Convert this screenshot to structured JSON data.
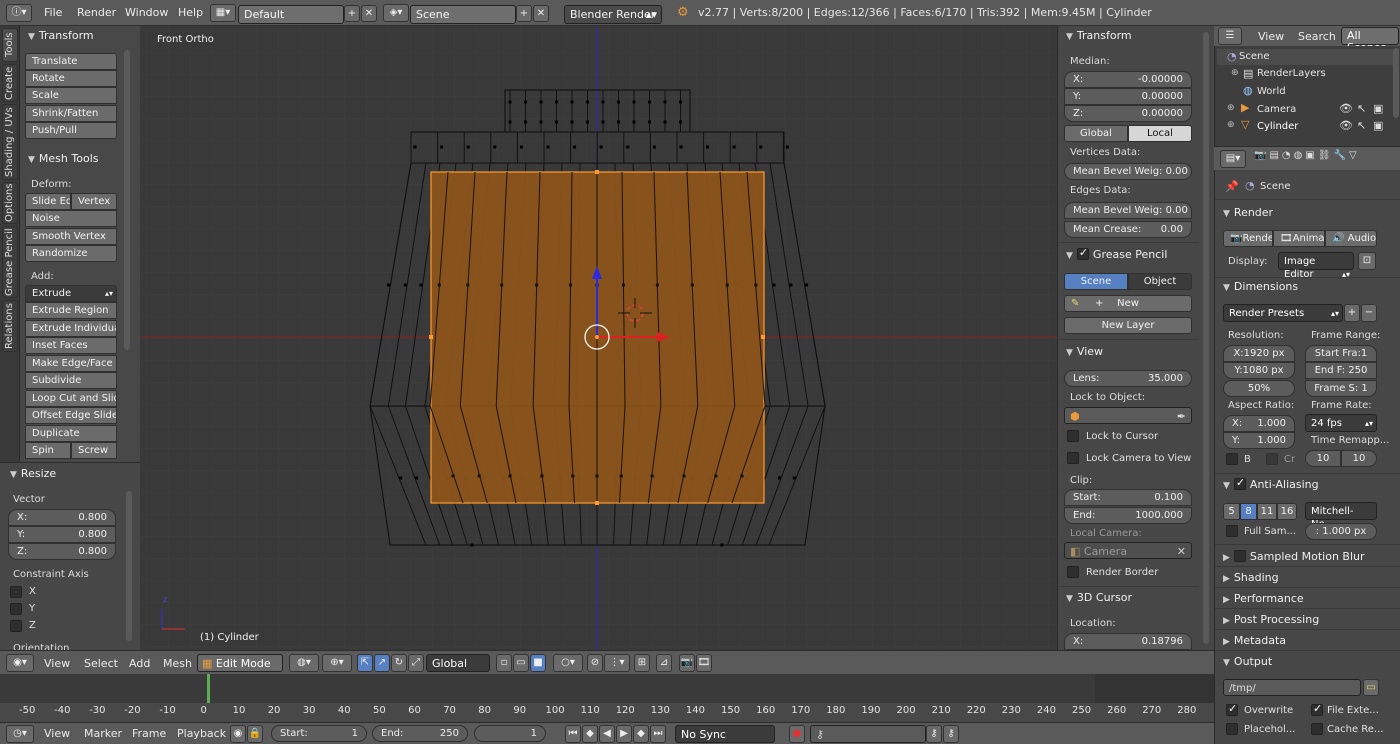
{
  "topbar": {
    "menus": [
      "File",
      "Render",
      "Window",
      "Help"
    ],
    "layout": "Default",
    "scene": "Scene",
    "engine": "Blender Render",
    "stats": "v2.77 | Verts:8/200 | Edges:12/366 | Faces:6/170 | Tris:392 | Mem:9.45M | Cylinder"
  },
  "tool_tabs": [
    "Tools",
    "Create",
    "Shading / UVs",
    "Options",
    "Grease Pencil",
    "Relations"
  ],
  "tools": {
    "transform_header": "Transform",
    "transform_buttons": [
      "Translate",
      "Rotate",
      "Scale",
      "Shrink/Fatten",
      "Push/Pull"
    ],
    "mesh_tools_header": "Mesh Tools",
    "deform_label": "Deform:",
    "slide_edge": "Slide Ed",
    "vertex": "Vertex",
    "deform_buttons": [
      "Noise",
      "Smooth Vertex",
      "Randomize"
    ],
    "add_label": "Add:",
    "extrude": "Extrude",
    "add_buttons": [
      "Extrude Region",
      "Extrude Individual",
      "Inset Faces",
      "Make Edge/Face",
      "Subdivide",
      "Loop Cut and Slide",
      "Offset Edge Slide",
      "Duplicate"
    ],
    "spin": "Spin",
    "screw": "Screw"
  },
  "operator": {
    "header": "Resize",
    "vector_label": "Vector",
    "x_label": "X:",
    "x": "0.800",
    "y_label": "Y:",
    "y": "0.800",
    "z_label": "Z:",
    "z": "0.800",
    "constraint_label": "Constraint Axis",
    "axes": [
      "X",
      "Y",
      "Z"
    ],
    "orientation_label": "Orientation"
  },
  "viewport": {
    "view_name": "Front Ortho",
    "object_label": "(1) Cylinder",
    "axis_z": "z",
    "colors": {
      "face_fill": "#8c531a",
      "selected_edge": "#ff9a2e",
      "wire": "#0c0c0c",
      "grid_bg": "#393939",
      "x_axis": "#b02020",
      "z_axis": "#2a2ad0"
    }
  },
  "npanel": {
    "transform_header": "Transform",
    "median_label": "Median:",
    "x_label": "X:",
    "x": "-0.00000",
    "y_label": "Y:",
    "y": "0.00000",
    "z_label": "Z:",
    "z": "0.00000",
    "global": "Global",
    "local": "Local",
    "vertices_data": "Vertices Data:",
    "mean_bevel_v": "Mean Bevel Weig: 0.00",
    "edges_data": "Edges Data:",
    "mean_bevel_e": "Mean Bevel Weig: 0.00",
    "mean_crease_label": "Mean Crease:",
    "mean_crease": "0.00",
    "grease_header": "Grease Pencil",
    "gp_scene": "Scene",
    "gp_object": "Object",
    "new": "New",
    "new_layer": "New Layer",
    "view_header": "View",
    "lens_label": "Lens:",
    "lens": "35.000",
    "lock_object": "Lock to Object:",
    "lock_cursor": "Lock to Cursor",
    "lock_camera": "Lock Camera to View",
    "clip_label": "Clip:",
    "start_label": "Start:",
    "start": "0.100",
    "end_label": "End:",
    "end": "1000.000",
    "local_camera": "Local Camera:",
    "camera": "Camera",
    "render_border": "Render Border",
    "cursor_header": "3D Cursor",
    "location_label": "Location:",
    "cx_label": "X:",
    "cx": "0.18796"
  },
  "outliner": {
    "view": "View",
    "search": "Search",
    "all_scenes": "All Scenes",
    "items": [
      "Scene",
      "RenderLayers",
      "World",
      "Camera",
      "Cylinder"
    ]
  },
  "properties": {
    "scene": "Scene",
    "render_header": "Render",
    "render_btn": "Render",
    "animation_btn": "Animati",
    "audio_btn": "Audio",
    "display_label": "Display:",
    "display_value": "Image Editor",
    "dimensions_header": "Dimensions",
    "presets": "Render Presets",
    "resolution_label": "Resolution:",
    "res_x": "X:1920 px",
    "res_y": "Y:1080 px",
    "res_pct": "50%",
    "frame_range_label": "Frame Range:",
    "start_frame": "Start Fra:1",
    "end_frame": "End F: 250",
    "frame_step": "Frame S: 1",
    "aspect_label": "Aspect Ratio:",
    "asp_x_label": "X:",
    "asp_x": "1.000",
    "asp_y_label": "Y:",
    "asp_y": "1.000",
    "frame_rate_label": "Frame Rate:",
    "fps": "24 fps",
    "time_remap": "Time Remapp...",
    "b_label": "B",
    "cr_label": "Cr",
    "remap_old": "10",
    "remap_new": "10",
    "aa_header": "Anti-Aliasing",
    "aa_samples": [
      "5",
      "8",
      "11",
      "16"
    ],
    "aa_filter": "Mitchell-Ne...",
    "full_sample": "Full Sam...",
    "filter_size": ": 1.000 px",
    "motion_blur": "Sampled Motion Blur",
    "shading": "Shading",
    "performance": "Performance",
    "post_processing": "Post Processing",
    "metadata": "Metadata",
    "output": "Output",
    "output_path": "/tmp/",
    "overwrite": "Overwrite",
    "file_ext": "File Exte...",
    "placeholders": "Placehol...",
    "cache_result": "Cache Re..."
  },
  "view3d_header": {
    "view": "View",
    "select": "Select",
    "add": "Add",
    "mesh": "Mesh",
    "mode": "Edit Mode",
    "orientation": "Global"
  },
  "timeline": {
    "ticks": [
      "-50",
      "-40",
      "-30",
      "-20",
      "-10",
      "0",
      "10",
      "20",
      "30",
      "40",
      "50",
      "60",
      "70",
      "80",
      "90",
      "100",
      "110",
      "120",
      "130",
      "140",
      "150",
      "160",
      "170",
      "180",
      "190",
      "200",
      "210",
      "220",
      "230",
      "240",
      "250",
      "260",
      "270",
      "280"
    ],
    "view": "View",
    "marker": "Marker",
    "frame": "Frame",
    "playback": "Playback",
    "start_label": "Start:",
    "start": "1",
    "end_label": "End:",
    "end": "250",
    "current": "1",
    "sync": "No Sync"
  }
}
